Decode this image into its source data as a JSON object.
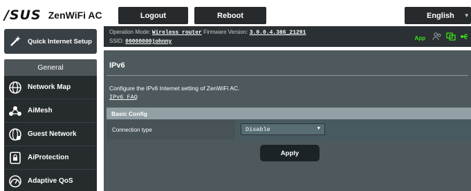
{
  "header": {
    "brand": "/SUS",
    "product": "ZenWiFi AC",
    "logout_label": "Logout",
    "reboot_label": "Reboot",
    "language": "English"
  },
  "sidebar": {
    "quick_setup": "Quick Internet Setup",
    "section_title": "General",
    "items": [
      {
        "label": "Network Map",
        "icon": "globe-icon"
      },
      {
        "label": "AiMesh",
        "icon": "mesh-icon"
      },
      {
        "label": "Guest Network",
        "icon": "guest-globe-icon"
      },
      {
        "label": "AiProtection",
        "icon": "lock-icon"
      },
      {
        "label": "Adaptive QoS",
        "icon": "gauge-icon"
      }
    ]
  },
  "status": {
    "operation_mode_label": "Operation Mode:",
    "operation_mode_value": "Wireless router",
    "firmware_label": "Firmware Version:",
    "firmware_value": "3.0.0.4.386_21291",
    "ssid_label": "SSID:",
    "ssid_value": "00000000johnny",
    "app_label": "App",
    "icons": [
      "users-icon",
      "network-status-icon",
      "usb-icon"
    ]
  },
  "main": {
    "page_title": "IPv6",
    "description": "Configure the IPv6 Internet setting of ZenWiFi AC.",
    "faq_link": "IPv6 FAQ",
    "section_title": "Basic Config",
    "field_label": "Connection type",
    "field_value": "Disable",
    "apply_label": "Apply"
  },
  "colors": {
    "accent_green": "#3adf1c",
    "panel_bg": "#4d595d",
    "menu_bg": "#262b2e"
  }
}
